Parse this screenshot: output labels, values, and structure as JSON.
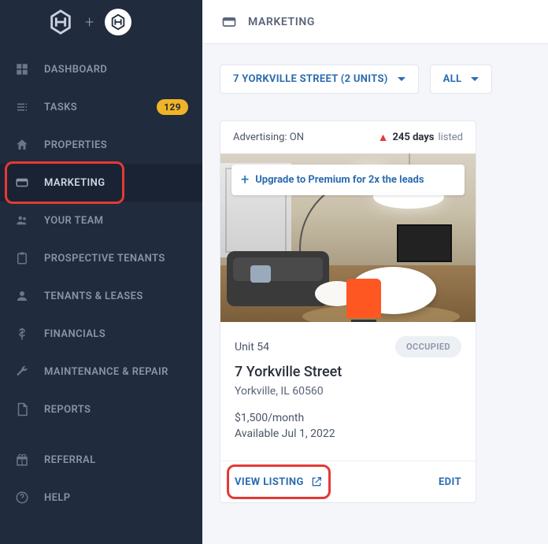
{
  "sidebar": {
    "items": [
      {
        "label": "DASHBOARD"
      },
      {
        "label": "TASKS",
        "badge": "129"
      },
      {
        "label": "PROPERTIES"
      },
      {
        "label": "MARKETING"
      },
      {
        "label": "YOUR TEAM"
      },
      {
        "label": "PROSPECTIVE TENANTS"
      },
      {
        "label": "TENANTS & LEASES"
      },
      {
        "label": "FINANCIALS"
      },
      {
        "label": "MAINTENANCE & REPAIR"
      },
      {
        "label": "REPORTS"
      },
      {
        "label": "REFERRAL"
      },
      {
        "label": "HELP"
      }
    ]
  },
  "topbar": {
    "title": "MARKETING"
  },
  "filters": {
    "property": "7 YORKVILLE STREET (2 UNITS)",
    "scope": "ALL"
  },
  "listing": {
    "advertising_label": "Advertising: ON",
    "days": "245 days",
    "listed_suffix": "listed",
    "upgrade": "Upgrade to Premium for 2x the leads",
    "unit": "Unit 54",
    "status": "OCCUPIED",
    "address": "7 Yorkville Street",
    "city": "Yorkville, IL 60560",
    "price": "$1,500/month",
    "available": "Available Jul 1, 2022",
    "view": "VIEW LISTING",
    "edit": "EDIT"
  }
}
